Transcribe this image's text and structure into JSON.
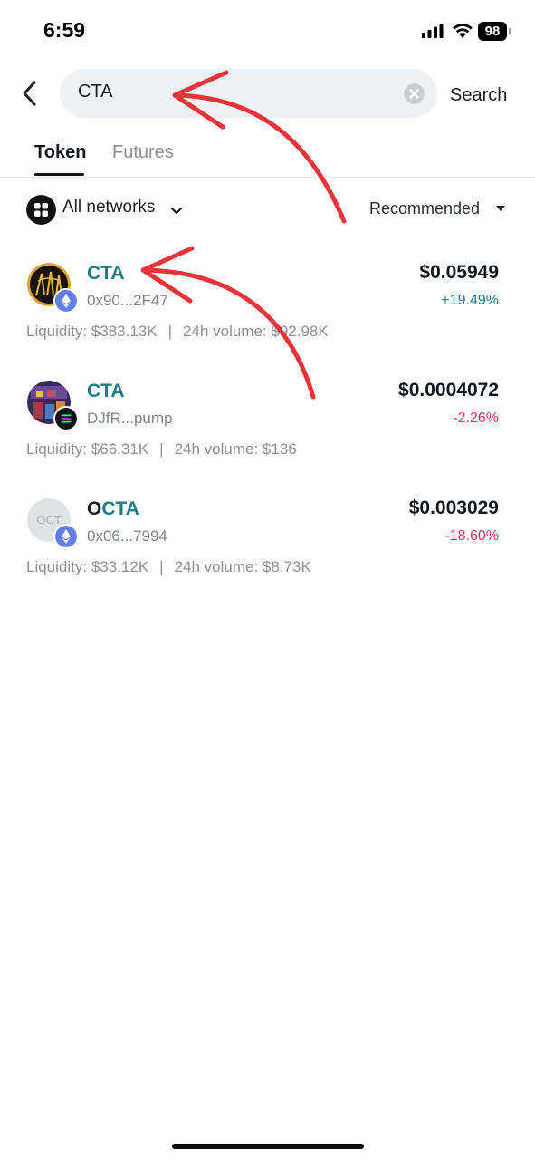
{
  "status_bar": {
    "time": "6:59",
    "battery": "98"
  },
  "search": {
    "value": "CTA",
    "button_label": "Search"
  },
  "tabs": [
    {
      "label": "Token",
      "active": true
    },
    {
      "label": "Futures",
      "active": false
    }
  ],
  "filters": {
    "network_label": "All networks",
    "sort_label": "Recommended"
  },
  "results": [
    {
      "symbol_plain": "",
      "symbol_match": "CTA",
      "address": "0x90...2F47",
      "chain": "ethereum-icon",
      "price": "$0.05949",
      "change": "+19.49%",
      "change_direction": "up",
      "liquidity": "Liquidity: $383.13K",
      "volume": "24h volume: $92.98K"
    },
    {
      "symbol_plain": "",
      "symbol_match": "CTA",
      "address": "DJfR...pump",
      "chain": "solana-icon",
      "price": "$0.0004072",
      "change": "-2.26%",
      "change_direction": "down",
      "liquidity": "Liquidity: $66.31K",
      "volume": "24h volume: $136"
    },
    {
      "symbol_plain": "O",
      "symbol_match": "CTA",
      "avatar_text": "OCT",
      "address": "0x06...7994",
      "chain": "ethereum-icon",
      "price": "$0.003029",
      "change": "-18.60%",
      "change_direction": "down",
      "liquidity": "Liquidity: $33.12K",
      "volume": "24h volume: $8.73K"
    }
  ],
  "separator": "|",
  "colors": {
    "accent": "#1c7d83",
    "negative": "#e0345a",
    "annotation_arrow": "#e8333b"
  }
}
